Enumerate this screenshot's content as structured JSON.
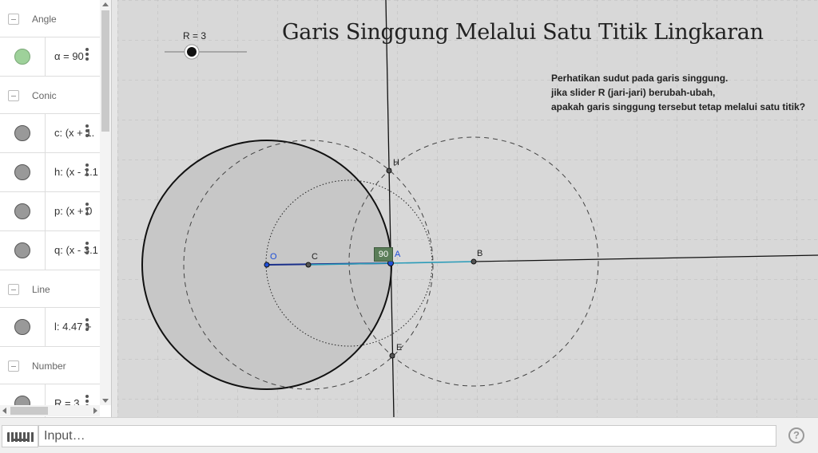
{
  "algebra": {
    "groups": [
      {
        "label": "Angle",
        "items": [
          {
            "expr": "α = 90",
            "color": "#9ed19a"
          }
        ]
      },
      {
        "label": "Conic",
        "items": [
          {
            "expr": "c: (x + 1."
          },
          {
            "expr": "h: (x - 1.1"
          },
          {
            "expr": "p: (x + 0"
          },
          {
            "expr": "q: (x - 3.1"
          }
        ]
      },
      {
        "label": "Line",
        "items": [
          {
            "expr": "l: 4.47 +"
          }
        ]
      },
      {
        "label": "Number",
        "items": [
          {
            "expr": "R = 3"
          }
        ]
      }
    ]
  },
  "graphics": {
    "title": "Garis Singgung Melalui Satu Titik Lingkaran",
    "slider_label": "R = 3",
    "notes": [
      "Perhatikan sudut pada garis singgung.",
      "jika slider R (jari-jari) berubah-ubah,",
      "apakah garis singgung tersebut tetap melalui satu titik?"
    ],
    "points": {
      "O": "O",
      "C": "C",
      "A": "A",
      "B": "B",
      "H": "H",
      "E": "E"
    },
    "angle_label": "90",
    "colors": {
      "background": "#d8d8d8",
      "grid": "#bdbdbd",
      "point_blue": "#1f4fd8",
      "segment_teal": "#2a9bb8",
      "angle_fill": "#5a7d58"
    }
  },
  "inputbar": {
    "placeholder": "Input…",
    "help_icon": "?"
  }
}
